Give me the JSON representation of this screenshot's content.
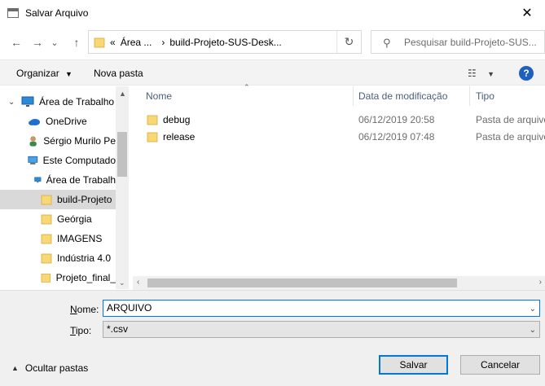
{
  "window": {
    "title": "Salvar Arquivo",
    "close_glyph": "✕"
  },
  "nav": {
    "back_glyph": "←",
    "forward_glyph": "→",
    "recent_glyph": "⌄",
    "up_glyph": "↑",
    "breadcrumb": [
      "«",
      "Área ...",
      "›",
      "build-Projeto-SUS-Desk..."
    ],
    "refresh_glyph": "↻",
    "search_placeholder": "Pesquisar build-Projeto-SUS..."
  },
  "toolbar": {
    "organize_label": "Organizar",
    "new_folder_label": "Nova pasta",
    "help_label": "?"
  },
  "sidebar": {
    "items": [
      {
        "label": "Área de Trabalho",
        "icon": "desktop-icon"
      },
      {
        "label": "OneDrive",
        "icon": "cloud-icon"
      },
      {
        "label": "Sérgio Murilo Pe",
        "icon": "user-icon"
      },
      {
        "label": "Este Computado",
        "icon": "computer-icon"
      },
      {
        "label": "Área de Trabalh",
        "icon": "desktop-icon"
      },
      {
        "label": "build-Projeto",
        "icon": "folder-icon"
      },
      {
        "label": "Geórgia",
        "icon": "folder-icon"
      },
      {
        "label": "IMAGENS",
        "icon": "folder-icon"
      },
      {
        "label": "Indústria 4.0",
        "icon": "folder-icon"
      },
      {
        "label": "Projeto_final_",
        "icon": "folder-icon"
      }
    ]
  },
  "file_list": {
    "columns": [
      "Nome",
      "Data de modificação",
      "Tipo"
    ],
    "rows": [
      {
        "name": "debug",
        "date": "06/12/2019 20:58",
        "type": "Pasta de arquivo"
      },
      {
        "name": "release",
        "date": "06/12/2019 07:48",
        "type": "Pasta de arquivo"
      }
    ]
  },
  "form": {
    "name_label_underlined": "N",
    "name_label_rest": "ome:",
    "name_value": "ARQUIVO",
    "type_label_underlined": "T",
    "type_label_rest": "ipo:",
    "type_value": "*.csv"
  },
  "footer": {
    "hide_folders_label": "Ocultar pastas",
    "save_label": "Salvar",
    "cancel_label": "Cancelar"
  },
  "colors": {
    "accent": "#0078d7",
    "folder": "#f8d775",
    "help": "#1f5fbf"
  }
}
